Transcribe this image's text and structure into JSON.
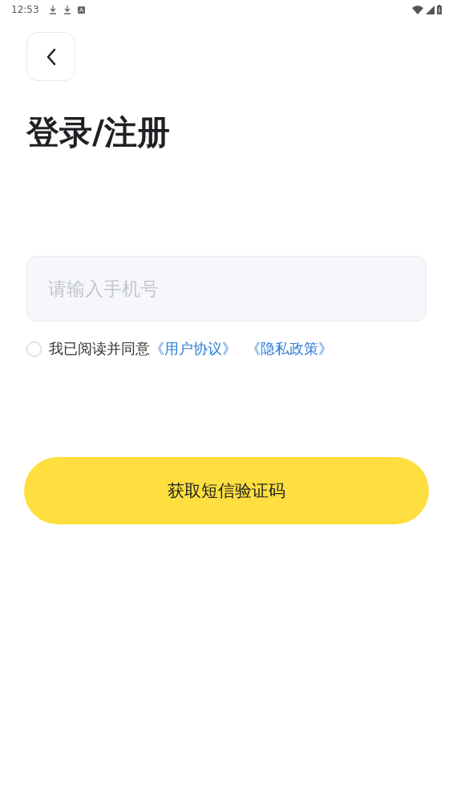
{
  "status_bar": {
    "time": "12:53"
  },
  "title": "登录/注册",
  "phone_field": {
    "placeholder": "请输入手机号"
  },
  "agreement": {
    "checked": false,
    "text": "我已阅读并同意",
    "links": [
      "《用户协议》",
      "《隐私政策》"
    ]
  },
  "submit_button": {
    "label": "获取短信验证码"
  }
}
